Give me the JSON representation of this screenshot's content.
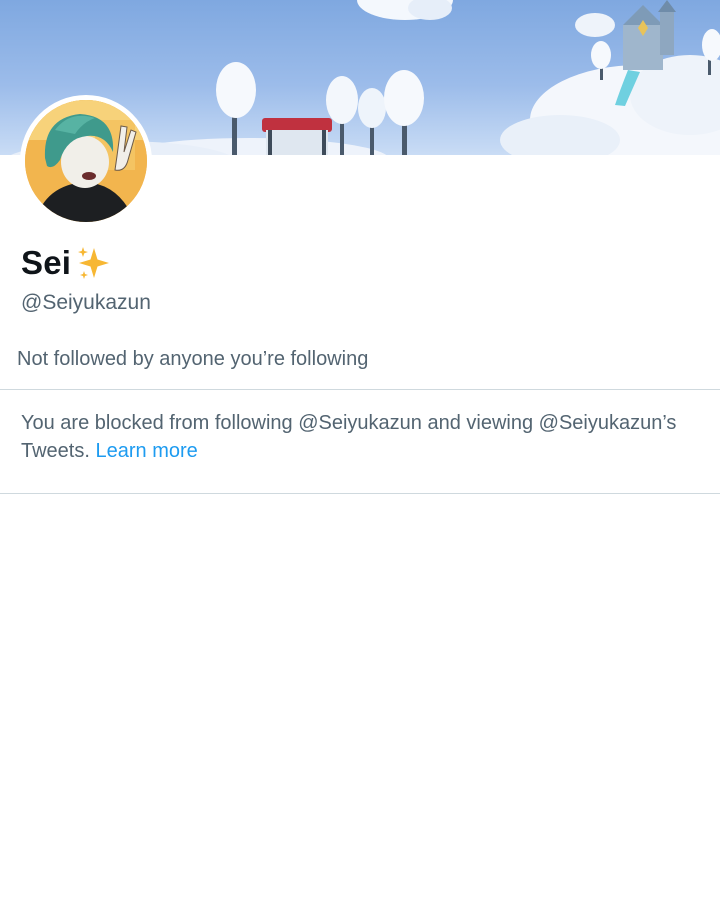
{
  "profile": {
    "display_name": "Sei",
    "name_emoji": "sparkles-icon",
    "handle": "@Seiyukazun",
    "followers_note": "Not followed by anyone you’re following"
  },
  "blocked_notice": {
    "message": "You are blocked from following @Seiyukazun and viewing @Seiyukazun’s Tweets.",
    "learn_more_label": "Learn more"
  },
  "colors": {
    "text_primary": "#0f1419",
    "text_secondary": "#536471",
    "link": "#1d9bf0",
    "divider": "#cfd9de",
    "sparkle": "#f7b733"
  }
}
